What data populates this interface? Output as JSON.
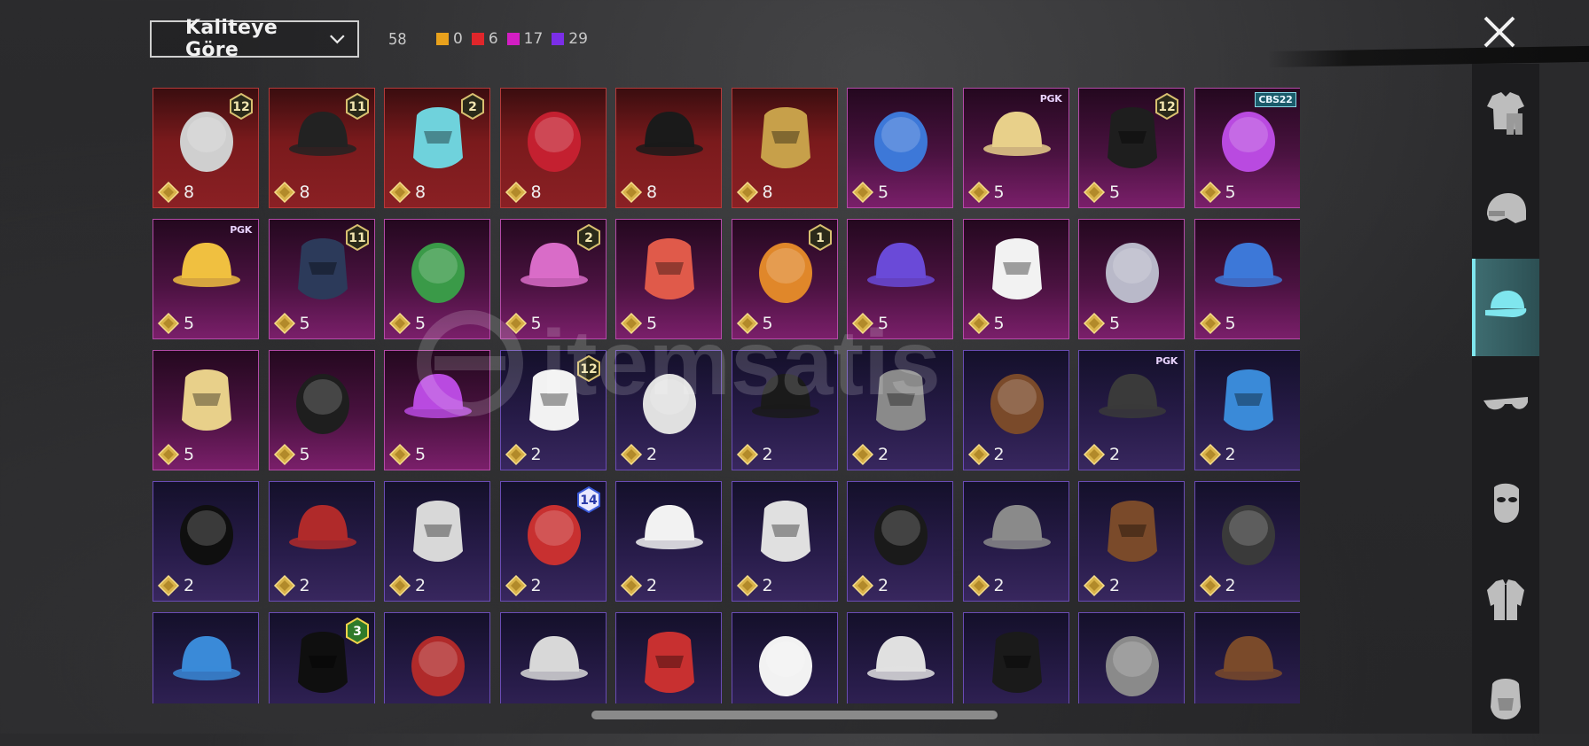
{
  "header": {
    "sort_label": "Kaliteye Göre",
    "total_count": "58",
    "quality_counts": [
      {
        "color": "#e8a11c",
        "value": "0"
      },
      {
        "color": "#e0262b",
        "value": "6"
      },
      {
        "color": "#d31ec4",
        "value": "17"
      },
      {
        "color": "#7b2ee8",
        "value": "29"
      }
    ]
  },
  "sidebar": {
    "items": [
      {
        "icon": "outfit-icon",
        "active": false
      },
      {
        "icon": "helmet-icon",
        "active": false
      },
      {
        "icon": "hat-icon",
        "active": true
      },
      {
        "icon": "glasses-icon",
        "active": false
      },
      {
        "icon": "mask-icon",
        "active": false
      },
      {
        "icon": "jacket-icon",
        "active": false
      },
      {
        "icon": "face-paint-icon",
        "active": false
      }
    ]
  },
  "items": [
    {
      "quality": "red",
      "cost": "8",
      "badge": "12",
      "art": "white-hair-bow"
    },
    {
      "quality": "red",
      "cost": "8",
      "badge": "11",
      "art": "black-hair"
    },
    {
      "quality": "red",
      "cost": "8",
      "badge": "2",
      "art": "teal-bucket-hat"
    },
    {
      "quality": "red",
      "cost": "8",
      "badge": "",
      "art": "red-oni-mask"
    },
    {
      "quality": "red",
      "cost": "8",
      "badge": "",
      "art": "black-ponytail"
    },
    {
      "quality": "red",
      "cost": "8",
      "badge": "",
      "art": "anubis-helmet"
    },
    {
      "quality": "pink",
      "cost": "5",
      "badge": "",
      "art": "pink-twin-hair"
    },
    {
      "quality": "pink",
      "cost": "5",
      "badge": "",
      "label": "PGK",
      "art": "black-cap-visor"
    },
    {
      "quality": "pink",
      "cost": "5",
      "badge": "12",
      "art": "orange-braids"
    },
    {
      "quality": "pink",
      "cost": "5",
      "badge": "",
      "label": "CBS22",
      "art": "blue-purple-hair"
    },
    {
      "quality": "pink",
      "cost": "5",
      "badge": "",
      "label": "PGK",
      "art": "panda-head"
    },
    {
      "quality": "pink",
      "cost": "5",
      "badge": "11",
      "art": "floral-veil"
    },
    {
      "quality": "pink",
      "cost": "5",
      "badge": "",
      "art": "blue-bird"
    },
    {
      "quality": "pink",
      "cost": "5",
      "badge": "2",
      "art": "blonde-cap"
    },
    {
      "quality": "pink",
      "cost": "5",
      "badge": "",
      "art": "mohawk-helmet"
    },
    {
      "quality": "pink",
      "cost": "5",
      "badge": "1",
      "art": "white-pigtails"
    },
    {
      "quality": "pink",
      "cost": "5",
      "badge": "",
      "art": "bunny-headphones"
    },
    {
      "quality": "pink",
      "cost": "5",
      "badge": "",
      "art": "duck-mask"
    },
    {
      "quality": "pink",
      "cost": "5",
      "badge": "",
      "art": "hooded-mask"
    },
    {
      "quality": "pink",
      "cost": "5",
      "badge": "",
      "art": "frog-hat"
    },
    {
      "quality": "pink",
      "cost": "5",
      "badge": "",
      "art": "flower-top-hat"
    },
    {
      "quality": "pink",
      "cost": "5",
      "badge": "",
      "art": "white-sun-hat"
    },
    {
      "quality": "pink",
      "cost": "5",
      "badge": "",
      "art": "skull-balaclava"
    },
    {
      "quality": "purple",
      "cost": "2",
      "badge": "12",
      "art": "bunny-helmet"
    },
    {
      "quality": "purple",
      "cost": "2",
      "badge": "",
      "art": "tactical-helmet"
    },
    {
      "quality": "purple",
      "cost": "2",
      "badge": "",
      "art": "red-hair-glasses"
    },
    {
      "quality": "purple",
      "cost": "2",
      "badge": "",
      "art": "colorful-helmet"
    },
    {
      "quality": "purple",
      "cost": "2",
      "badge": "",
      "art": "white-wide-hat"
    },
    {
      "quality": "purple",
      "cost": "2",
      "badge": "",
      "label": "PGK",
      "art": "grey-bob"
    },
    {
      "quality": "purple",
      "cost": "2",
      "badge": "",
      "art": "red-moto-helmet"
    },
    {
      "quality": "purple",
      "cost": "2",
      "badge": "",
      "art": "cyber-helmet-hair"
    },
    {
      "quality": "purple",
      "cost": "2",
      "badge": "",
      "art": "brown-hair"
    },
    {
      "quality": "purple",
      "cost": "2",
      "badge": "",
      "art": "goggles-helmet"
    },
    {
      "quality": "purple",
      "cost": "2",
      "badge": "14",
      "art": "spiked-cap"
    },
    {
      "quality": "purple",
      "cost": "2",
      "badge": "",
      "art": "cowboy-hat"
    },
    {
      "quality": "purple",
      "cost": "2",
      "badge": "",
      "art": "black-mask"
    },
    {
      "quality": "purple",
      "cost": "2",
      "badge": "",
      "art": "shark-hood"
    },
    {
      "quality": "purple",
      "cost": "2",
      "badge": "",
      "art": "black-top-hat"
    },
    {
      "quality": "purple",
      "cost": "2",
      "badge": "",
      "art": "red-fedora"
    },
    {
      "quality": "purple",
      "cost": "2",
      "badge": "",
      "art": "white-shark-hood"
    },
    {
      "quality": "purple",
      "cost": "",
      "badge": "",
      "art": "red-bucket-hat"
    },
    {
      "quality": "purple",
      "cost": "",
      "badge": "3",
      "art": "flower-crown"
    },
    {
      "quality": "purple",
      "cost": "",
      "badge": "",
      "art": "cake-hat"
    },
    {
      "quality": "purple",
      "cost": "",
      "badge": "",
      "art": "burger-hat"
    },
    {
      "quality": "purple",
      "cost": "",
      "badge": "",
      "art": "headlamp"
    },
    {
      "quality": "purple",
      "cost": "",
      "badge": "",
      "art": "navy-cap"
    },
    {
      "quality": "purple",
      "cost": "",
      "badge": "",
      "art": "teal-beanie"
    },
    {
      "quality": "purple",
      "cost": "",
      "badge": "",
      "art": "black-baseball-cap"
    },
    {
      "quality": "purple",
      "cost": "",
      "badge": "",
      "art": "maroon-fedora"
    },
    {
      "quality": "purple",
      "cost": "",
      "badge": "",
      "art": "checkered-hood"
    }
  ],
  "watermark": {
    "text": "itemsatis"
  }
}
